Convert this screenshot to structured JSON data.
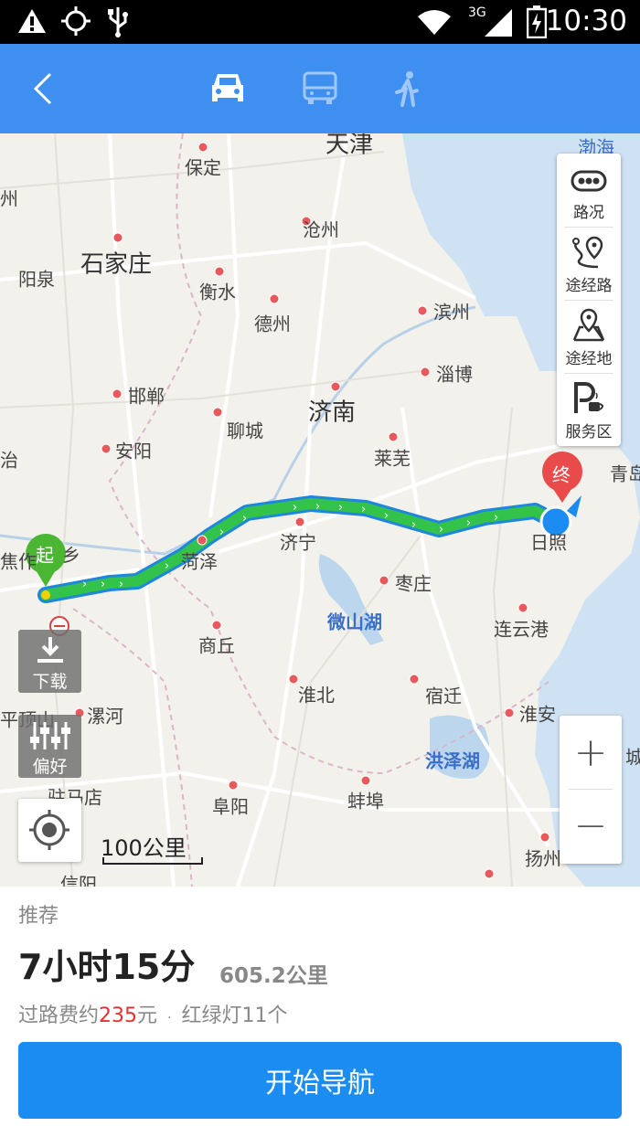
{
  "status_bar": {
    "time": "10:30",
    "network": "3G",
    "icons": [
      "warning-icon",
      "gps-icon",
      "usb-icon",
      "wifi-icon",
      "signal-icon",
      "battery-charging-icon"
    ]
  },
  "toolbar": {
    "icons": [
      "back-icon",
      "car-icon",
      "bus-icon",
      "walk-icon"
    ]
  },
  "map": {
    "cities": [
      {
        "name": "天津",
        "kind": "big"
      },
      {
        "name": "保定"
      },
      {
        "name": "渤海",
        "kind": "water"
      },
      {
        "name": "州"
      },
      {
        "name": "沧州"
      },
      {
        "name": "石家庄",
        "kind": "big"
      },
      {
        "name": "阳泉"
      },
      {
        "name": "衡水"
      },
      {
        "name": "德州"
      },
      {
        "name": "滨州"
      },
      {
        "name": "淄博"
      },
      {
        "name": "邯郸"
      },
      {
        "name": "济南",
        "kind": "big"
      },
      {
        "name": "聊城"
      },
      {
        "name": "安阳"
      },
      {
        "name": "治"
      },
      {
        "name": "莱芜"
      },
      {
        "name": "青岛"
      },
      {
        "name": "乡"
      },
      {
        "name": "焦作"
      },
      {
        "name": "菏泽"
      },
      {
        "name": "济宁"
      },
      {
        "name": "日照"
      },
      {
        "name": "枣庄"
      },
      {
        "name": "微山湖",
        "kind": "water"
      },
      {
        "name": "商丘"
      },
      {
        "name": "连云港"
      },
      {
        "name": "淮北"
      },
      {
        "name": "宿迁"
      },
      {
        "name": "平顶山"
      },
      {
        "name": "漯河"
      },
      {
        "name": "淮安"
      },
      {
        "name": "洪泽湖",
        "kind": "water"
      },
      {
        "name": "驻马店"
      },
      {
        "name": "阜阳"
      },
      {
        "name": "蚌埠"
      },
      {
        "name": "扬州"
      },
      {
        "name": "信阳"
      },
      {
        "name": "城"
      }
    ],
    "start_marker": "起",
    "end_marker": "终",
    "scale_label": "100公里",
    "route_color": "#33c24a"
  },
  "side_panel": [
    {
      "label": "路况",
      "icon": "traffic-icon"
    },
    {
      "label": "途经路",
      "icon": "route-via-icon"
    },
    {
      "label": "途经地",
      "icon": "waypoint-icon"
    },
    {
      "label": "服务区",
      "icon": "service-area-icon"
    }
  ],
  "left_buttons": {
    "download": "下载",
    "preference": "偏好"
  },
  "zoom": {
    "in": "+",
    "out": "−"
  },
  "route": {
    "recommend": "推荐",
    "duration": "7小时15分",
    "distance": "605.2公里",
    "toll_prefix": "过路费约",
    "toll_amount": "235",
    "toll_suffix": "元",
    "separator": "·",
    "lights": "红绿灯11个"
  },
  "navigate_button": "开始导航",
  "colors": {
    "accent": "#3f8ff0",
    "nav_button": "#1a8cf2",
    "route": "#33c24a",
    "toll": "#e53030"
  }
}
